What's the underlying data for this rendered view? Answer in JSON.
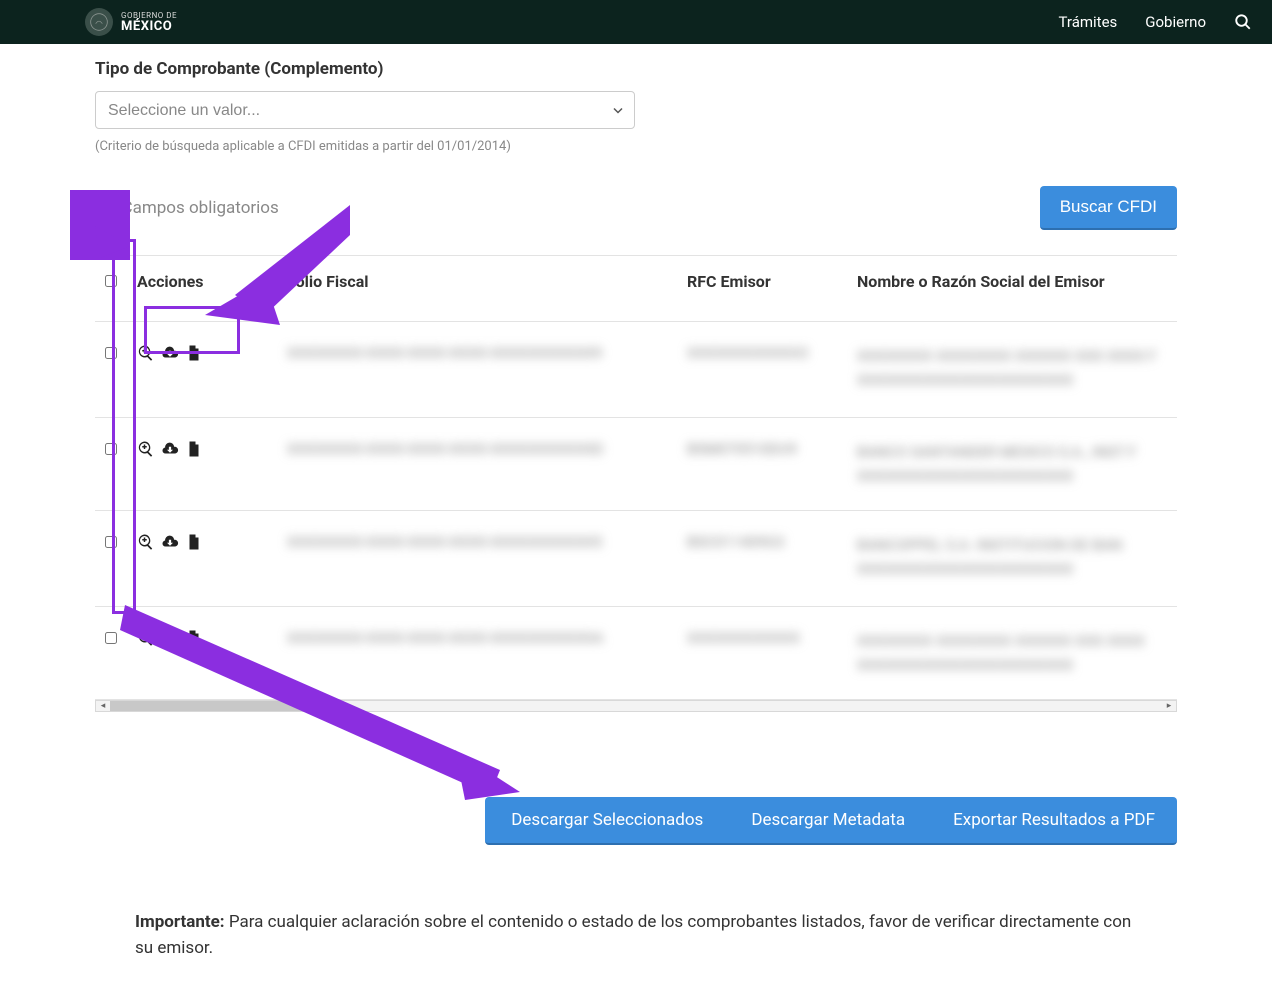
{
  "header": {
    "logo_top": "GOBIERNO DE",
    "logo_bottom": "MÉXICO",
    "links": {
      "tramites": "Trámites",
      "gobierno": "Gobierno"
    }
  },
  "form": {
    "tipo_label": "Tipo de Comprobante (Complemento)",
    "select_placeholder": "Seleccione un valor...",
    "criteria_note": "(Criterio de búsqueda aplicable a CFDI emitidas a partir del 01/01/2014)",
    "required_note": "* Campos obligatorios",
    "search_button": "Buscar CFDI"
  },
  "table": {
    "headers": {
      "acciones": "Acciones",
      "folio": "Folio Fiscal",
      "rfc": "RFC Emisor",
      "nombre": "Nombre o Razón Social del Emisor"
    },
    "rows": [
      {
        "folio_end": "9",
        "rfc_end": "3",
        "nombre_partial": "",
        "nombre_end": "F"
      },
      {
        "folio_end": "D",
        "rfc_partial": "BSM070510DU9",
        "nombre_partial": "BANCO SANTANDER MEXICO S.A., INST",
        "nombre_end": "F"
      },
      {
        "folio_end": "5",
        "rfc_partial": "BSC011409G3",
        "nombre_partial": "BANCOPPEL S.A. INSTITUCION DE BAN"
      },
      {
        "folio_end": "A",
        "rfc_partial": "",
        "nombre_partial": ""
      }
    ]
  },
  "actions": {
    "descargar_seleccionados": "Descargar Seleccionados",
    "descargar_metadata": "Descargar Metadata",
    "exportar_pdf": "Exportar Resultados a PDF"
  },
  "note": {
    "prefix": "Importante:",
    "text": " Para cualquier aclaración sobre el contenido o estado de los comprobantes listados, favor de verificar directamente con su emisor."
  }
}
